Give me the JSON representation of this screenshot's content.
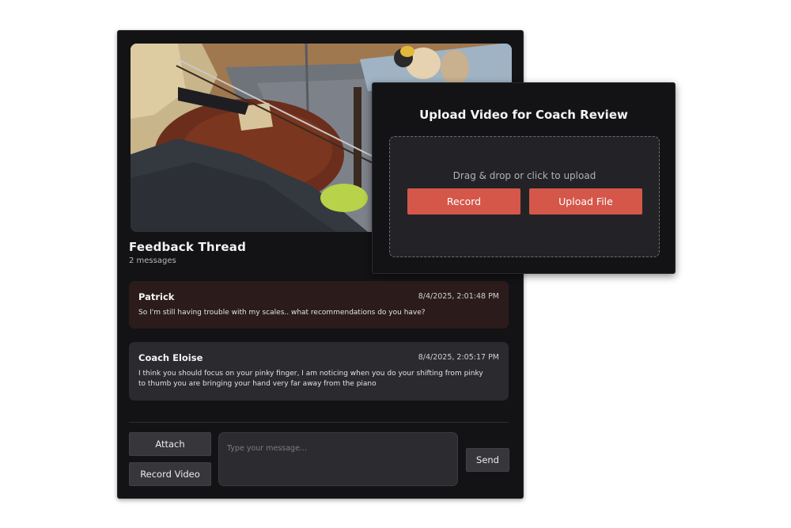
{
  "thread": {
    "title": "Feedback Thread",
    "count": "2 messages",
    "messages": [
      {
        "author": "Patrick",
        "time": "8/4/2025, 2:01:48 PM",
        "text": "So I'm still having trouble with my scales.. what recommendations do you have?"
      },
      {
        "author": "Coach Eloise",
        "time": "8/4/2025, 2:05:17 PM",
        "text": "I think you should focus on your pinky finger, I am noticing when you do your shifting from pinky to thumb you are bringing your hand very far away from the piano"
      }
    ]
  },
  "composer": {
    "attach_label": "Attach",
    "record_video_label": "Record Video",
    "placeholder": "Type your message...",
    "send_label": "Send"
  },
  "upload": {
    "title": "Upload Video for Coach Review",
    "drop_text": "Drag & drop or click to upload",
    "record_label": "Record",
    "upload_file_label": "Upload File"
  },
  "colors": {
    "panel_bg": "#131316",
    "accent": "#d4574a",
    "student_message_bg": "#2b1c1b",
    "coach_message_bg": "#2a2a2f"
  }
}
